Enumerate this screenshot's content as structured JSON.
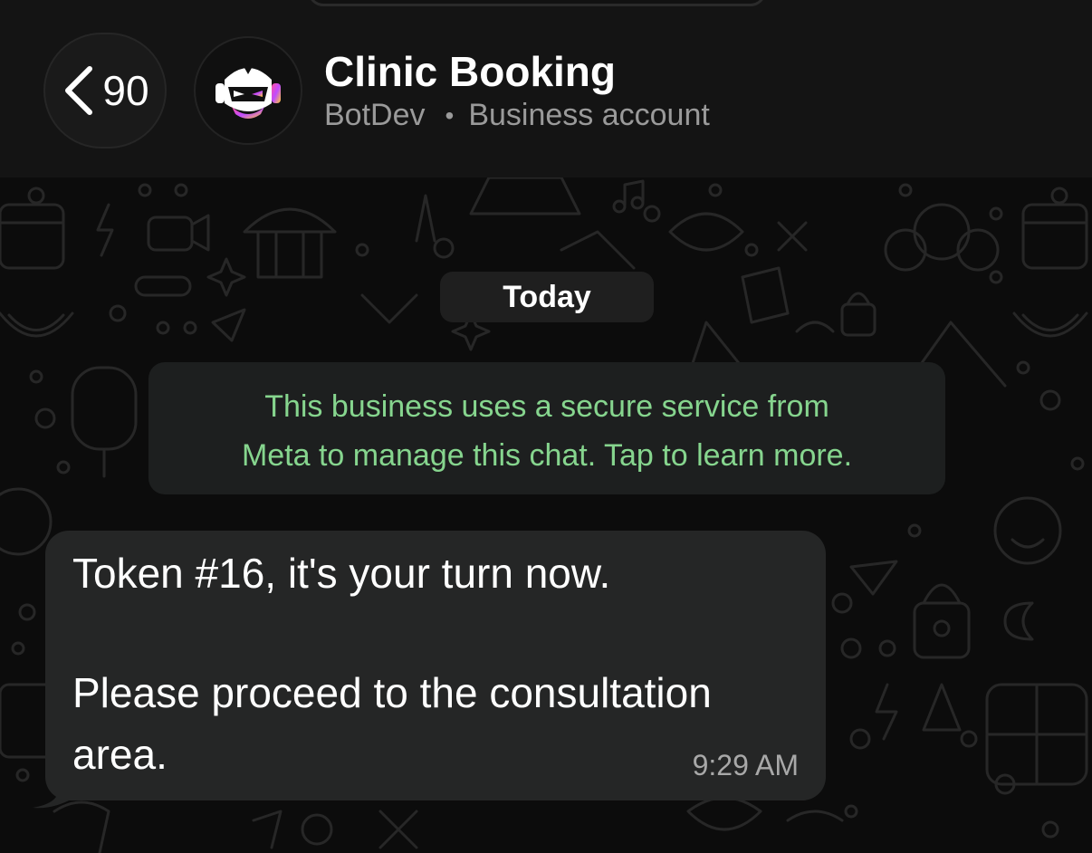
{
  "header": {
    "back_count": "90",
    "title": "Clinic Booking",
    "subtitle_name": "BotDev",
    "subtitle_separator": "•",
    "subtitle_type": "Business account",
    "avatar_icon": "robot-icon"
  },
  "chat": {
    "date_label": "Today",
    "system_notice": {
      "line1": "This business uses a secure service from",
      "line2": "Meta to manage this chat. Tap to learn more."
    },
    "messages": [
      {
        "line1": "Token #16, it's your turn now.",
        "line2": "Please proceed to the consultation",
        "line3": "area.",
        "time": "9:29 AM"
      }
    ]
  },
  "colors": {
    "header_bg": "#141414",
    "chat_bg": "#0c0c0c",
    "bubble_bg": "#252626",
    "notice_text": "#86d58e",
    "muted_text": "#9a9a9a"
  }
}
